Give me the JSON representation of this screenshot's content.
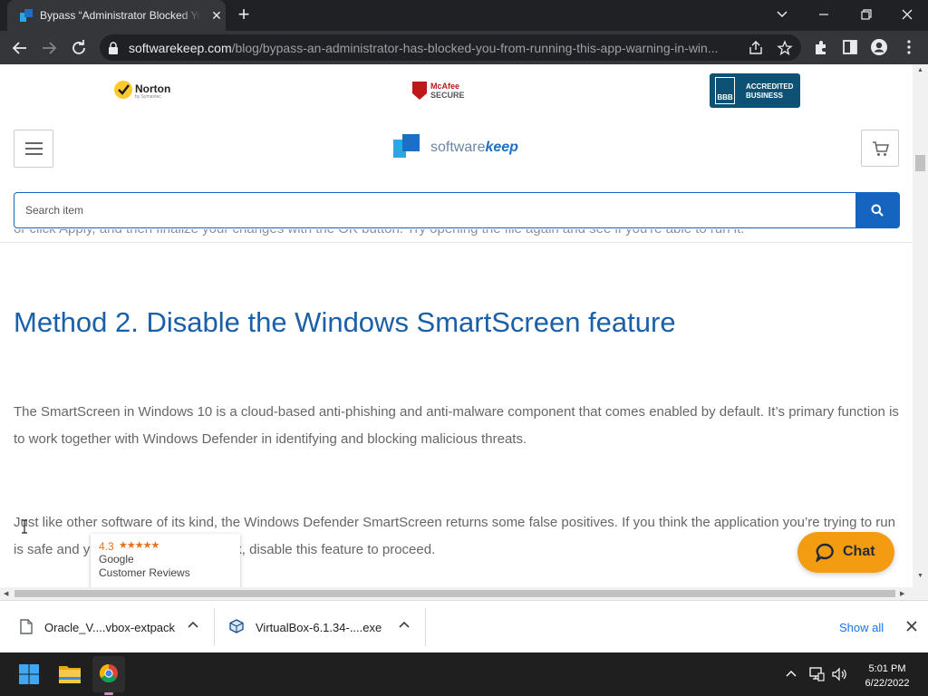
{
  "browser": {
    "tab_title": "Bypass “Administrator Blocked Yo",
    "url_host": "softwarekeep.com",
    "url_path": "/blog/bypass-an-administrator-has-blocked-you-from-running-this-app-warning-in-win..."
  },
  "trust_badges": {
    "norton": {
      "name": "Norton",
      "sub": "by Symantec"
    },
    "mcafee": {
      "line1": "McAfee",
      "line2": "SECURE"
    },
    "bbb": {
      "mark": "BBB",
      "line1": "ACCREDITED",
      "line2": "BUSINESS"
    }
  },
  "site": {
    "brand_plain": "software",
    "brand_bold": "keep",
    "search_placeholder": "Search item"
  },
  "article": {
    "cut_line": "or click Apply, and then finalize your changes with the OK button. Try opening the file again and see if you're able to run it.",
    "heading": "Method 2. Disable the Windows SmartScreen feature",
    "para1": "The SmartScreen in Windows 10 is a cloud-based anti-phishing and anti-malware component that comes enabled by default. It’s primary function is to work together with Windows Defender in identifying and blocking malicious threats.",
    "para2": "Just like other software of its kind, the Windows Defender SmartScreen returns some false positives. If you think the application you’re trying to run is safe and you’re willing to take a risk, disable this feature to proceed."
  },
  "reviews_badge": {
    "rating": "4.3",
    "stars": "★★★★★",
    "source": "Google",
    "label": "Customer Reviews"
  },
  "chat": {
    "label": "Chat"
  },
  "downloads": {
    "items": [
      {
        "name": "Oracle_V....vbox-extpack"
      },
      {
        "name": "VirtualBox-6.1.34-....exe"
      }
    ],
    "show_all": "Show all"
  },
  "taskbar": {
    "time": "5:01 PM",
    "date": "6/22/2022"
  },
  "colors": {
    "accent": "#1565c0",
    "heading": "#1a5fa8",
    "chat": "#f39c12"
  }
}
